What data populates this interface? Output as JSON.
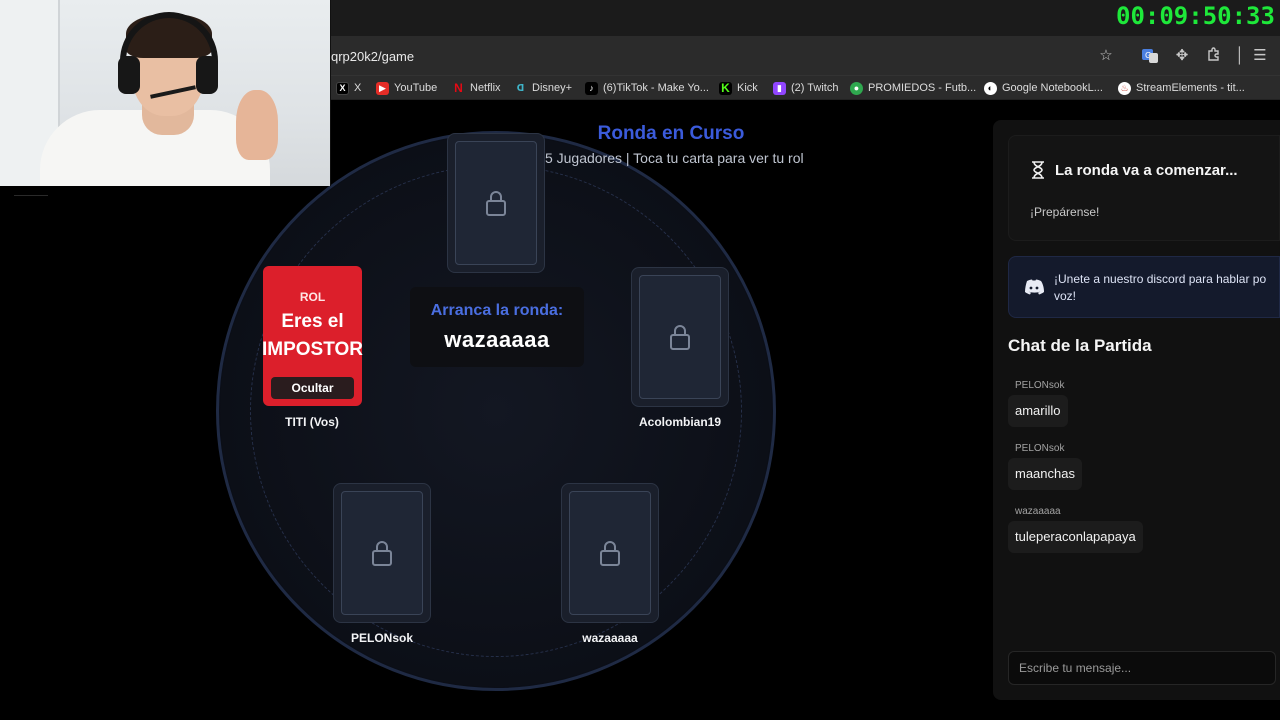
{
  "browser": {
    "url": "qrp20k2/game",
    "bookmarks": [
      {
        "label": "X",
        "icon": "x-logo-icon"
      },
      {
        "label": "YouTube",
        "icon": "youtube-icon"
      },
      {
        "label": "Netflix",
        "icon": "netflix-icon"
      },
      {
        "label": "Disney+",
        "icon": "disney-icon"
      },
      {
        "label": "(6)TikTok - Make Yo...",
        "icon": "tiktok-icon"
      },
      {
        "label": "Kick",
        "icon": "kick-icon"
      },
      {
        "label": "(2) Twitch",
        "icon": "twitch-icon"
      },
      {
        "label": "PROMIEDOS - Futb...",
        "icon": "soccer-ball-icon"
      },
      {
        "label": "Google NotebookL...",
        "icon": "notebooklm-icon"
      },
      {
        "label": "StreamElements - tit...",
        "icon": "streamelements-icon"
      }
    ]
  },
  "overlay": {
    "timer": "00:09:50:33"
  },
  "game": {
    "title": "Ronda en Curso",
    "subtitle": "5 Jugadores | Toca tu carta para ver tu rol",
    "my_card": {
      "role_label": "ROL",
      "role_line1": "Eres el",
      "role_line2": "IMPOSTOR",
      "hide_button": "Ocultar",
      "player": "TITI (Vos)"
    },
    "starter": {
      "label": "Arranca la ronda:",
      "name": "wazaaaaa"
    },
    "players": [
      {
        "name": "Acolombian19"
      },
      {
        "name": "PELONsok"
      },
      {
        "name": "wazaaaaa"
      }
    ]
  },
  "panel": {
    "status_title": "La ronda va a comenzar...",
    "status_sub": "¡Prepárense!",
    "discord_line1": "¡Unete a nuestro discord para hablar po",
    "discord_line2": "voz!",
    "chat_title": "Chat de la Partida",
    "messages": [
      {
        "user": "PELONsok",
        "text": "amarillo"
      },
      {
        "user": "PELONsok",
        "text": "maanchas"
      },
      {
        "user": "wazaaaaa",
        "text": "tuleperaconlapapaya"
      }
    ],
    "chat_placeholder": "Escribe tu mensaje..."
  },
  "colors": {
    "accent_blue": "#3b5bdb",
    "impostor_red": "#dc1f2b",
    "timer_green": "#1ee83a"
  }
}
